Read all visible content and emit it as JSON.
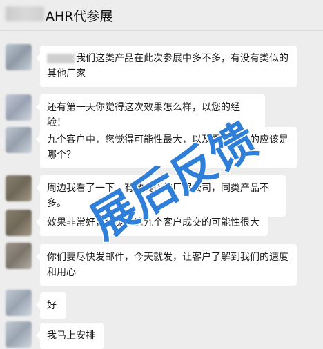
{
  "header": {
    "title": "AHR代参展"
  },
  "messages": [
    {
      "text": "我们这类产品在此次参展中多不多，有没有类似的其他厂家"
    },
    {
      "text": "还有第一天你觉得这次效果怎么样，以您的经验！"
    },
    {
      "text": "九个客户中，您觉得可能性最大，以及需求最大的应该是哪个？"
    },
    {
      "text": "周边我看了一下，有做类似的厂家公司，同类产品不多。"
    },
    {
      "text": "效果非常好，我觉得这九个客户成交的可能性很大"
    },
    {
      "text": "你们要尽快发邮件，今天就发，让客户了解到我们的速度和用心"
    },
    {
      "text": "好"
    },
    {
      "text": "我马上安排"
    }
  ],
  "watermark": {
    "text": "展后反馈",
    "color": "#2f7fd8"
  }
}
